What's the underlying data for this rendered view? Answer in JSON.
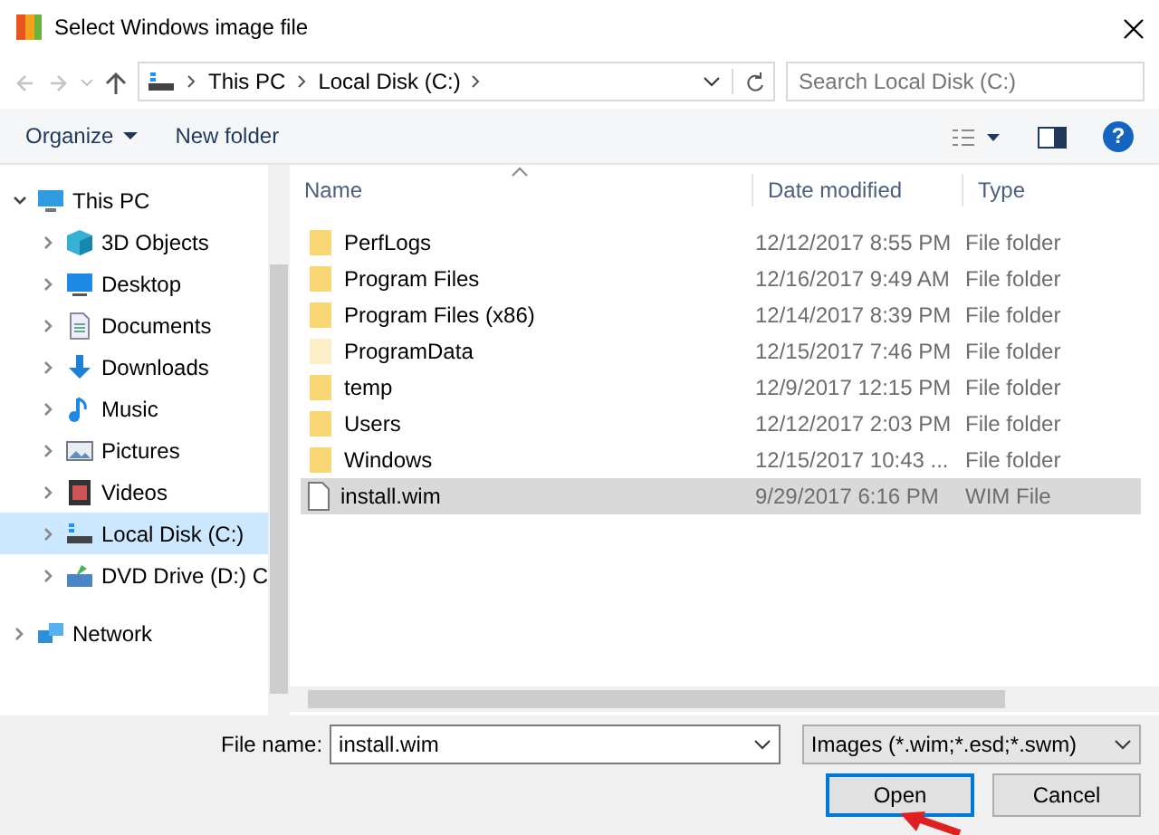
{
  "window": {
    "title": "Select Windows image file"
  },
  "address": {
    "crumbs": [
      "This PC",
      "Local Disk (C:)"
    ]
  },
  "search": {
    "placeholder": "Search Local Disk (C:)"
  },
  "toolbar": {
    "organize": "Organize",
    "new_folder": "New folder",
    "help": "?"
  },
  "sidebar": {
    "items": [
      {
        "label": "This PC",
        "kind": "pc",
        "expanded": true,
        "selected": false,
        "children": [
          {
            "label": "3D Objects",
            "kind": "cube",
            "expanded": false,
            "selected": false
          },
          {
            "label": "Desktop",
            "kind": "desktop",
            "expanded": false,
            "selected": false
          },
          {
            "label": "Documents",
            "kind": "documents",
            "expanded": false,
            "selected": false
          },
          {
            "label": "Downloads",
            "kind": "downloads",
            "expanded": false,
            "selected": false
          },
          {
            "label": "Music",
            "kind": "music",
            "expanded": false,
            "selected": false
          },
          {
            "label": "Pictures",
            "kind": "pictures",
            "expanded": false,
            "selected": false
          },
          {
            "label": "Videos",
            "kind": "videos",
            "expanded": false,
            "selected": false
          },
          {
            "label": "Local Disk (C:)",
            "kind": "disk",
            "expanded": false,
            "selected": true
          },
          {
            "label": "DVD Drive (D:) C",
            "kind": "dvd",
            "expanded": false,
            "selected": false
          }
        ]
      },
      {
        "label": "Network",
        "kind": "network",
        "expanded": false,
        "selected": false
      }
    ]
  },
  "table": {
    "columns": [
      "Name",
      "Date modified",
      "Type"
    ],
    "rows": [
      {
        "name": "PerfLogs",
        "date": "12/12/2017 8:55 PM",
        "type": "File folder",
        "kind": "folder",
        "hidden": false,
        "selected": false
      },
      {
        "name": "Program Files",
        "date": "12/16/2017 9:49 AM",
        "type": "File folder",
        "kind": "folder",
        "hidden": false,
        "selected": false
      },
      {
        "name": "Program Files (x86)",
        "date": "12/14/2017 8:39 PM",
        "type": "File folder",
        "kind": "folder",
        "hidden": false,
        "selected": false
      },
      {
        "name": "ProgramData",
        "date": "12/15/2017 7:46 PM",
        "type": "File folder",
        "kind": "folder",
        "hidden": true,
        "selected": false
      },
      {
        "name": "temp",
        "date": "12/9/2017 12:15 PM",
        "type": "File folder",
        "kind": "folder",
        "hidden": false,
        "selected": false
      },
      {
        "name": "Users",
        "date": "12/12/2017 2:03 PM",
        "type": "File folder",
        "kind": "folder",
        "hidden": false,
        "selected": false
      },
      {
        "name": "Windows",
        "date": "12/15/2017 10:43 ...",
        "type": "File folder",
        "kind": "folder",
        "hidden": false,
        "selected": false
      },
      {
        "name": "install.wim",
        "date": "9/29/2017 6:16 PM",
        "type": "WIM File",
        "kind": "file",
        "hidden": false,
        "selected": true
      }
    ]
  },
  "footer": {
    "file_name_label": "File name:",
    "file_name": "install.wim",
    "filter": "Images (*.wim;*.esd;*.swm)",
    "buttons": [
      {
        "label": "Open",
        "default": true
      },
      {
        "label": "Cancel",
        "default": false
      }
    ]
  }
}
